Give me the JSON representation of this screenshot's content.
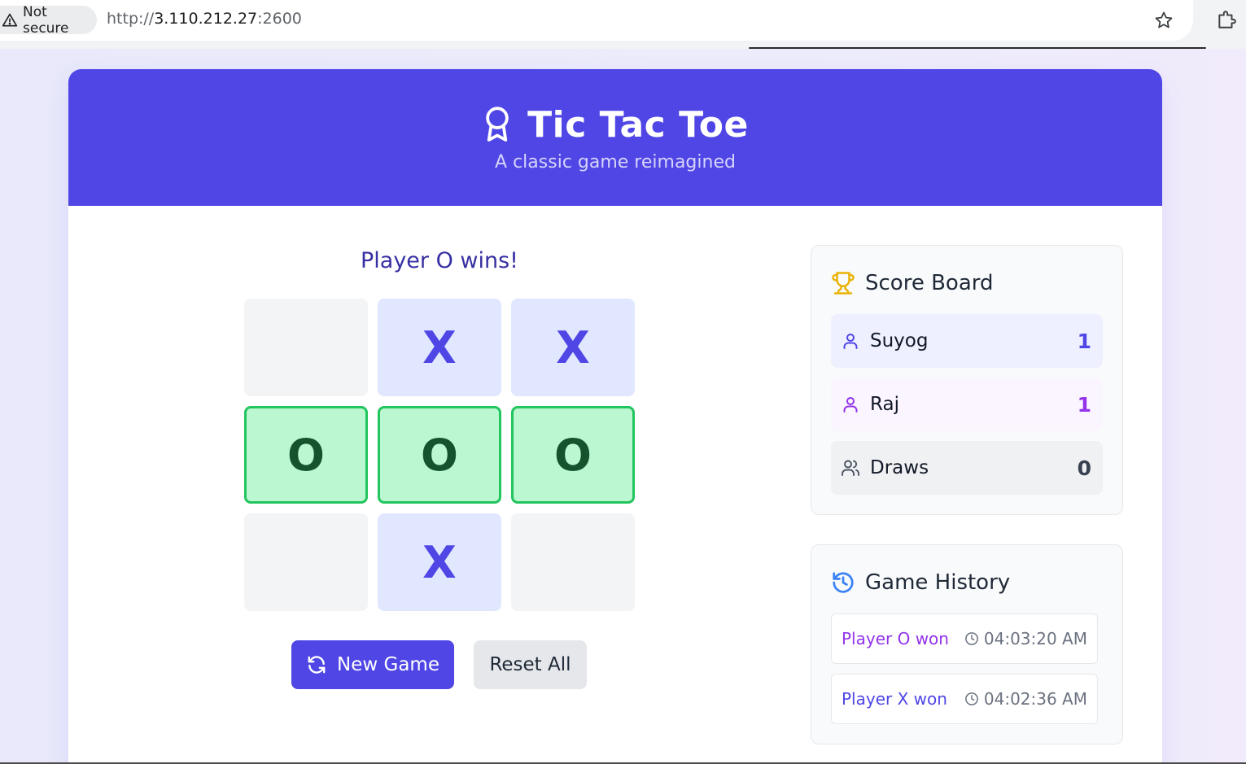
{
  "browser": {
    "security_label": "Not secure",
    "url_scheme": "http://",
    "url_host": "3.110.212.27",
    "url_port": ":2600",
    "icons": {
      "warning": "warning-triangle-icon",
      "bookmark": "star-icon",
      "extensions": "puzzle-icon"
    }
  },
  "header": {
    "title": "Tic Tac Toe",
    "subtitle": "A classic game reimagined",
    "icon": "award-icon"
  },
  "game": {
    "status": "Player O wins!",
    "board": [
      "",
      "X",
      "X",
      "O",
      "O",
      "O",
      "",
      "X",
      ""
    ],
    "winning_cells": [
      3,
      4,
      5
    ],
    "new_game_label": "New Game",
    "reset_label": "Reset All"
  },
  "scoreboard": {
    "title": "Score Board",
    "rows": [
      {
        "name": "Suyog",
        "score": "1"
      },
      {
        "name": "Raj",
        "score": "1"
      },
      {
        "name": "Draws",
        "score": "0"
      }
    ]
  },
  "history": {
    "title": "Game History",
    "items": [
      {
        "result": "Player O won",
        "time": "04:03:20 AM"
      },
      {
        "result": "Player X won",
        "time": "04:02:36 AM"
      }
    ]
  },
  "colors": {
    "accent": "#4f46e5",
    "o_accent": "#9333ea",
    "win_border": "#22c55e",
    "win_fill": "#bbf7d0",
    "trophy": "#eab308"
  }
}
